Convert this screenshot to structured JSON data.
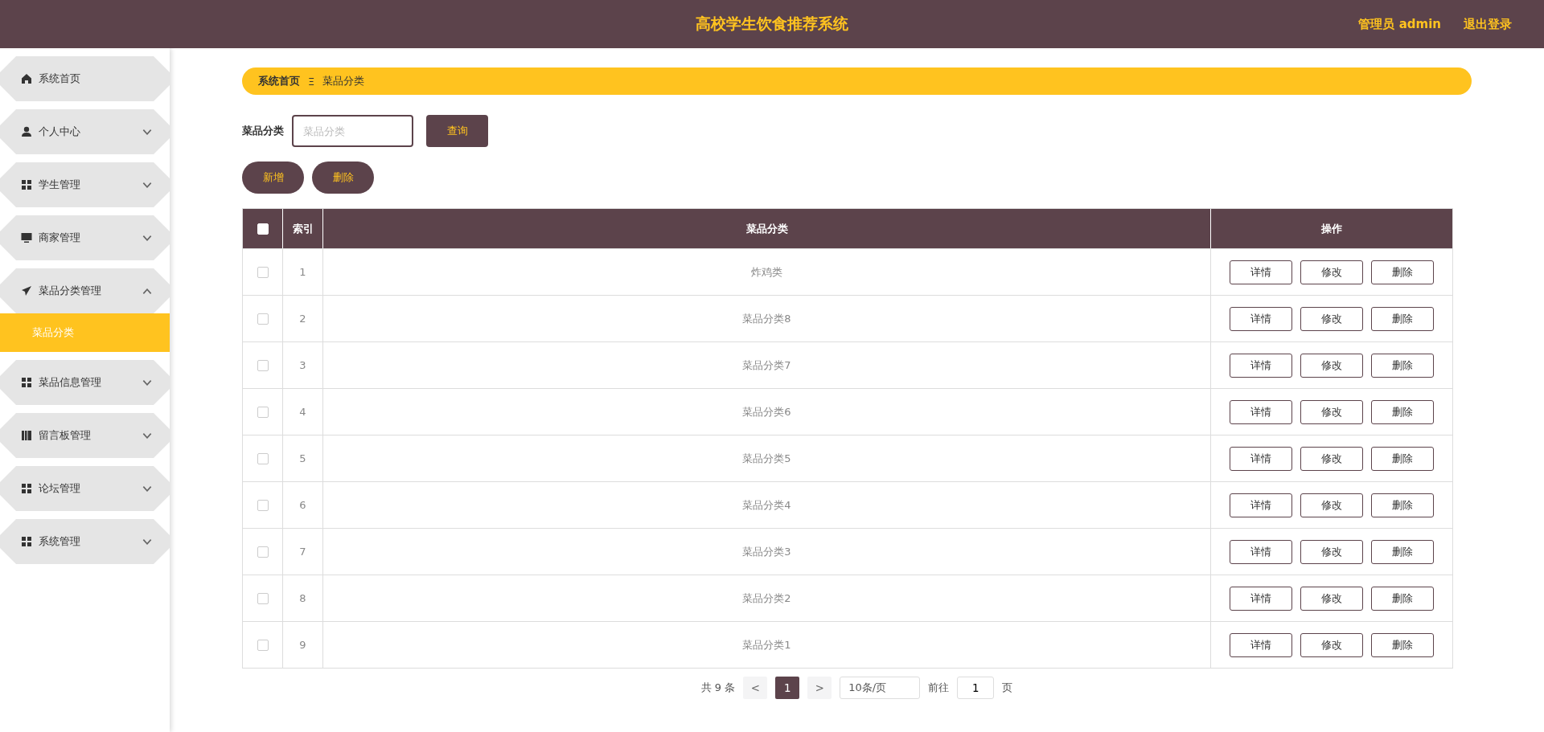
{
  "header": {
    "title": "高校学生饮食推荐系统",
    "user": "管理员 admin",
    "logout": "退出登录"
  },
  "sidebar": {
    "items": [
      {
        "label": "系统首页",
        "kind": "home"
      },
      {
        "label": "个人中心",
        "kind": "user",
        "expanded": false
      },
      {
        "label": "学生管理",
        "kind": "grid",
        "expanded": false
      },
      {
        "label": "商家管理",
        "kind": "monitor",
        "expanded": false
      },
      {
        "label": "菜品分类管理",
        "kind": "plane",
        "expanded": true,
        "children": [
          {
            "label": "菜品分类",
            "selected": true
          }
        ]
      },
      {
        "label": "菜品信息管理",
        "kind": "grid",
        "expanded": false
      },
      {
        "label": "留言板管理",
        "kind": "book",
        "expanded": false
      },
      {
        "label": "论坛管理",
        "kind": "grid",
        "expanded": false
      },
      {
        "label": "系统管理",
        "kind": "grid",
        "expanded": false
      }
    ]
  },
  "breadcrumb": {
    "items": [
      "系统首页",
      "菜品分类"
    ],
    "separator": "Ξ"
  },
  "search": {
    "label": "菜品分类",
    "placeholder": "菜品分类",
    "button": "查询"
  },
  "actions": [
    "新增",
    "删除"
  ],
  "table": {
    "columns": [
      "索引",
      "菜品分类",
      "操作"
    ],
    "select_all_checked": false,
    "rows": [
      {
        "index": "1",
        "name": "炸鸡类",
        "checked": false,
        "buttons": [
          "详情",
          "修改",
          "删除"
        ]
      },
      {
        "index": "2",
        "name": "菜品分类8",
        "checked": false,
        "buttons": [
          "详情",
          "修改",
          "删除"
        ]
      },
      {
        "index": "3",
        "name": "菜品分类7",
        "checked": false,
        "buttons": [
          "详情",
          "修改",
          "删除"
        ]
      },
      {
        "index": "4",
        "name": "菜品分类6",
        "checked": false,
        "buttons": [
          "详情",
          "修改",
          "删除"
        ]
      },
      {
        "index": "5",
        "name": "菜品分类5",
        "checked": false,
        "buttons": [
          "详情",
          "修改",
          "删除"
        ]
      },
      {
        "index": "6",
        "name": "菜品分类4",
        "checked": false,
        "buttons": [
          "详情",
          "修改",
          "删除"
        ]
      },
      {
        "index": "7",
        "name": "菜品分类3",
        "checked": false,
        "buttons": [
          "详情",
          "修改",
          "删除"
        ]
      },
      {
        "index": "8",
        "name": "菜品分类2",
        "checked": false,
        "buttons": [
          "详情",
          "修改",
          "删除"
        ]
      },
      {
        "index": "9",
        "name": "菜品分类1",
        "checked": false,
        "buttons": [
          "详情",
          "修改",
          "删除"
        ]
      }
    ]
  },
  "pagination": {
    "total": "共 9 条",
    "prev": "<",
    "pages": [
      {
        "label": "1",
        "selected": true
      }
    ],
    "next": ">",
    "page_size": "10条/页",
    "goto_label": "前往",
    "goto_value": "1",
    "goto_suffix": "页"
  }
}
